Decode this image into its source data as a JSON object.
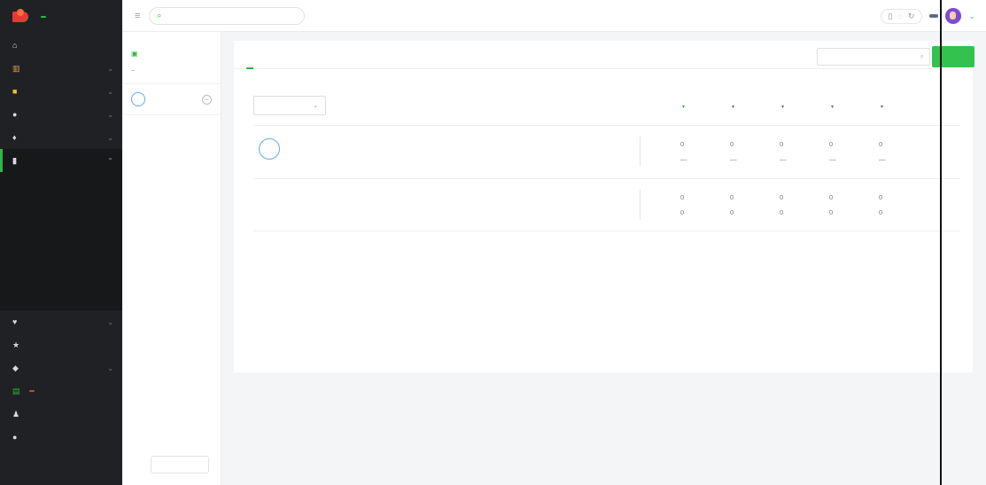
{
  "sidebar": {
    "logo": "",
    "logo_sub": "",
    "logo_badge": "",
    "items": [
      {
        "label": "",
        "icon": "home-icon"
      },
      {
        "label": "",
        "icon": "chart-icon"
      },
      {
        "label": "",
        "icon": "shop-icon"
      },
      {
        "label": "",
        "icon": "search-icon"
      },
      {
        "label": "",
        "icon": "hot-icon"
      },
      {
        "label": "",
        "icon": "monitor-icon"
      }
    ],
    "sub_items": [
      "",
      "",
      "",
      "",
      "",
      ""
    ],
    "items_bottom": [
      {
        "label": "",
        "icon": "promote-icon"
      },
      {
        "label": "",
        "icon": "star-icon"
      },
      {
        "label": "",
        "icon": "tools-icon"
      },
      {
        "label": "",
        "icon": "buy-icon",
        "badge": ""
      },
      {
        "label": "",
        "icon": "user-icon"
      },
      {
        "label": "",
        "icon": "help-icon"
      }
    ]
  },
  "topbar": {
    "search_placeholder": "",
    "version": "",
    "vip": ""
  },
  "account_panel": {
    "title": "",
    "manage": "",
    "group_all": "",
    "group_ungrouped": "",
    "account_name": "",
    "avatar_text": "",
    "add_button": ""
  },
  "main": {
    "tabs": [
      "",
      ""
    ],
    "search_placeholder": "",
    "export": "",
    "filter_select": "",
    "columns": [
      "",
      "",
      "",
      "",
      "",
      ""
    ],
    "rows": [
      {
        "avatar_text": "",
        "name": "",
        "fans": "",
        "lines": [
          {
            "label": "",
            "values": [
              "0",
              "0",
              "0",
              "0",
              "0"
            ]
          },
          {
            "label": "",
            "values": [
              "—",
              "—",
              "—",
              "—",
              "—"
            ]
          }
        ]
      },
      {
        "name": "",
        "lines": [
          {
            "label": "",
            "values": [
              "0",
              "0",
              "0",
              "0",
              "0"
            ]
          },
          {
            "label": "",
            "values": [
              "0",
              "0",
              "0",
              "0",
              "0"
            ]
          }
        ]
      }
    ]
  }
}
